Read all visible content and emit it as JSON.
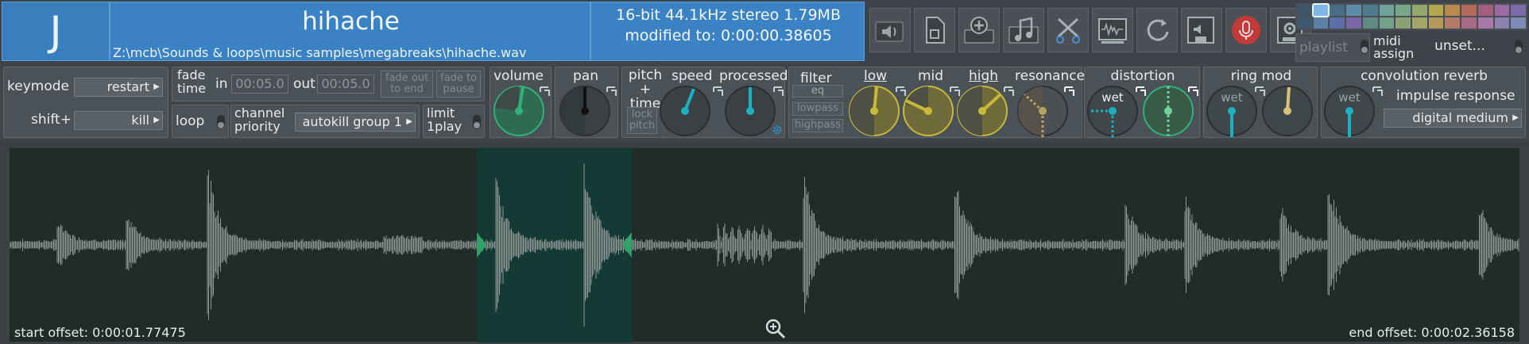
{
  "header": {
    "key": "J",
    "sample_name": "hihache",
    "path": "Z:\\mcb\\Sounds & loops\\music samples\\megabreaks\\hihache.wav",
    "format": "16-bit 44.1kHz stereo 1.79MB",
    "modified": "modified to: 0:00:00.38605",
    "tools": [
      "speaker-icon",
      "file-icon",
      "add-mix-icon",
      "music-note-icon",
      "scissors-icon",
      "waveform-edit-icon",
      "refresh-icon",
      "save-audio-icon",
      "microphone-icon",
      "settings-file-icon"
    ],
    "palette_colors": [
      "#3d5566",
      "#7fb6e6",
      "#4a6d86",
      "#5d8ca8",
      "#4f7c8c",
      "#6fa39a",
      "#78a78a",
      "#94a86b",
      "#b4a84e",
      "#b88a4e",
      "#b46a5a",
      "#a45e7d",
      "#9a6aa5",
      "#7a6aa8",
      "#3e5a70",
      "#5c7fa4",
      "#5e6fa8",
      "#7a66a6",
      "#5e8c84",
      "#74a08a",
      "#8ca276",
      "#a2a666",
      "#b69a5c",
      "#b27c6a",
      "#aa6a86",
      "#a878a8",
      "#8c82b0",
      "#7c8ab8"
    ],
    "playlist": "playlist",
    "midi_label": "midi assign",
    "midi_value": "unset..."
  },
  "controls": {
    "keymode_label": "keymode",
    "keymode_value": "restart",
    "shift_label": "shift+",
    "shift_value": "kill",
    "fade_label": "fade time",
    "fade_in_label": "in",
    "fade_in_value": "00:05.0",
    "fade_out_label": "out",
    "fade_out_value": "00:05.0",
    "fade_out_end": "fade out to end",
    "fade_pause": "fade to pause",
    "loop_label": "loop",
    "priority_label": "channel priority",
    "priority_value": "autokill group 1",
    "limit_label": "limit 1play",
    "volume_label": "volume",
    "pan_label": "pan",
    "pitch_time_label": "pitch + time",
    "speed_label": "speed",
    "processed_label": "processed",
    "lock_pitch": "lock pitch",
    "filter_label": "filter",
    "eq_label": "eq",
    "lowpass": "lowpass",
    "highpass": "highpass",
    "low_label": "low",
    "mid_label": "mid",
    "high_label": "high",
    "resonance_label": "resonance",
    "distortion_label": "distortion",
    "wet_label": "wet",
    "ringmod_label": "ring mod",
    "reverb_label": "convolution reverb",
    "impulse_label": "impulse response",
    "impulse_value": "digital medium"
  },
  "waveform": {
    "start_offset": "start offset: 0:00:01.77475",
    "end_offset": "end offset: 0:00:02.36158",
    "selection_start_fraction": 0.3095,
    "selection_end_fraction": 0.412
  },
  "colors": {
    "accent_blue": "#3a82c4",
    "volume_green": "#2fb37a",
    "speed_teal": "#1fb0c0",
    "eq_yellow": "#c9b93a",
    "waveform_bg": "#1f2c2a",
    "selection_bg": "#143a35"
  }
}
